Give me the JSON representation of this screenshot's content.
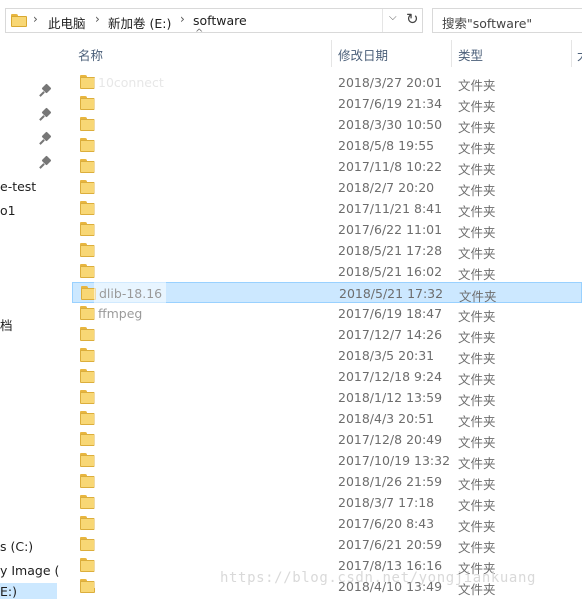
{
  "address": {
    "crumbs": [
      "此电脑",
      "新加卷 (E:)",
      "software"
    ],
    "chevron": "›",
    "dropdown_glyph": "⌵",
    "refresh_glyph": "↻"
  },
  "search": {
    "placeholder": "搜索\"software\""
  },
  "columns": {
    "name": "名称",
    "modified": "修改日期",
    "type": "类型",
    "size": "大"
  },
  "nav": {
    "items": [
      "e-test",
      "o1",
      "档",
      "s (C:)",
      "y Image (",
      "E:)"
    ]
  },
  "files": [
    {
      "name": "10connect",
      "date": "2018/3/27 20:01",
      "type": "文件夹"
    },
    {
      "name": "",
      "date": "2017/6/19 21:34",
      "type": "文件夹"
    },
    {
      "name": "",
      "date": "2018/3/30 10:50",
      "type": "文件夹"
    },
    {
      "name": "",
      "date": "2018/5/8 19:55",
      "type": "文件夹"
    },
    {
      "name": "",
      "date": "2017/11/8 10:22",
      "type": "文件夹"
    },
    {
      "name": "",
      "date": "2018/2/7 20:20",
      "type": "文件夹"
    },
    {
      "name": "",
      "date": "2017/11/21 8:41",
      "type": "文件夹"
    },
    {
      "name": "",
      "date": "2017/6/22 11:01",
      "type": "文件夹"
    },
    {
      "name": "",
      "date": "2018/5/21 17:28",
      "type": "文件夹"
    },
    {
      "name": "",
      "date": "2018/5/21 16:02",
      "type": "文件夹"
    },
    {
      "name": "dlib-18.16",
      "date": "2018/5/21 17:32",
      "type": "文件夹"
    },
    {
      "name": "ffmpeg",
      "date": "2017/6/19 18:47",
      "type": "文件夹"
    },
    {
      "name": "",
      "date": "2017/12/7 14:26",
      "type": "文件夹"
    },
    {
      "name": "",
      "date": "2018/3/5 20:31",
      "type": "文件夹"
    },
    {
      "name": "",
      "date": "2017/12/18 9:24",
      "type": "文件夹"
    },
    {
      "name": "",
      "date": "2018/1/12 13:59",
      "type": "文件夹"
    },
    {
      "name": "",
      "date": "2018/4/3 20:51",
      "type": "文件夹"
    },
    {
      "name": "",
      "date": "2017/12/8 20:49",
      "type": "文件夹"
    },
    {
      "name": "",
      "date": "2017/10/19 13:32",
      "type": "文件夹"
    },
    {
      "name": "",
      "date": "2018/1/26 21:59",
      "type": "文件夹"
    },
    {
      "name": "",
      "date": "2018/3/7 17:18",
      "type": "文件夹"
    },
    {
      "name": "",
      "date": "2017/6/20 8:43",
      "type": "文件夹"
    },
    {
      "name": "",
      "date": "2017/6/21 20:59",
      "type": "文件夹"
    },
    {
      "name": "",
      "date": "2017/8/13 16:16",
      "type": "文件夹"
    },
    {
      "name": "",
      "date": "2018/4/10 13:49",
      "type": "文件夹"
    }
  ],
  "selected_index": 10,
  "watermark": "https://blog.csdn.net/yongjiankuang",
  "colors": {
    "selection": "#cce8ff",
    "selection_border": "#99d1ff",
    "folder": "#f8d775",
    "header_text": "#4c607a"
  }
}
